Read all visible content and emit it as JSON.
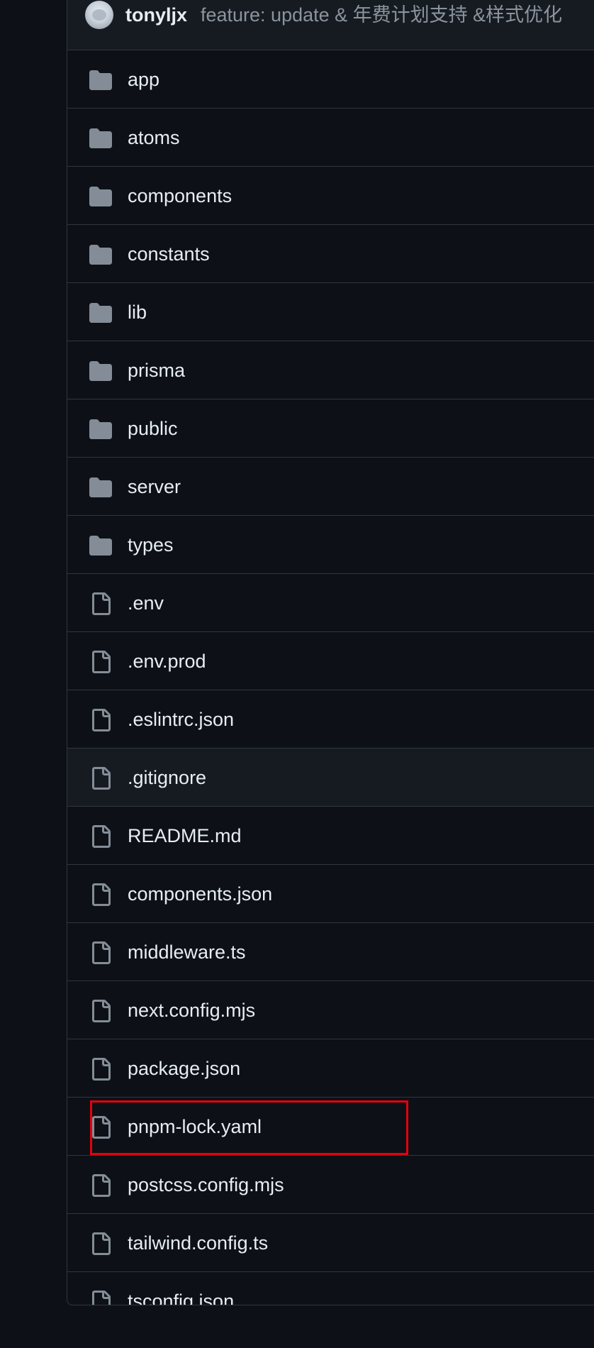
{
  "commit": {
    "author": "tonyljx",
    "message": "feature: update & 年费计划支持 &样式优化"
  },
  "files": [
    {
      "name": "app",
      "type": "folder",
      "icon": "folder-icon"
    },
    {
      "name": "atoms",
      "type": "folder",
      "icon": "folder-icon"
    },
    {
      "name": "components",
      "type": "folder",
      "icon": "folder-icon"
    },
    {
      "name": "constants",
      "type": "folder",
      "icon": "folder-icon"
    },
    {
      "name": "lib",
      "type": "folder",
      "icon": "folder-icon"
    },
    {
      "name": "prisma",
      "type": "folder",
      "icon": "folder-icon"
    },
    {
      "name": "public",
      "type": "folder",
      "icon": "folder-icon"
    },
    {
      "name": "server",
      "type": "folder",
      "icon": "folder-icon"
    },
    {
      "name": "types",
      "type": "folder",
      "icon": "folder-icon"
    },
    {
      "name": ".env",
      "type": "file",
      "icon": "file-icon"
    },
    {
      "name": ".env.prod",
      "type": "file",
      "icon": "file-icon"
    },
    {
      "name": ".eslintrc.json",
      "type": "file",
      "icon": "file-icon"
    },
    {
      "name": ".gitignore",
      "type": "file",
      "icon": "file-icon",
      "hovered": true
    },
    {
      "name": "README.md",
      "type": "file",
      "icon": "file-icon"
    },
    {
      "name": "components.json",
      "type": "file",
      "icon": "file-icon"
    },
    {
      "name": "middleware.ts",
      "type": "file",
      "icon": "file-icon"
    },
    {
      "name": "next.config.mjs",
      "type": "file",
      "icon": "file-icon"
    },
    {
      "name": "package.json",
      "type": "file",
      "icon": "file-icon"
    },
    {
      "name": "pnpm-lock.yaml",
      "type": "file",
      "icon": "file-icon",
      "highlighted": true
    },
    {
      "name": "postcss.config.mjs",
      "type": "file",
      "icon": "file-icon"
    },
    {
      "name": "tailwind.config.ts",
      "type": "file",
      "icon": "file-icon"
    },
    {
      "name": "tsconfig.json",
      "type": "file",
      "icon": "file-icon"
    }
  ],
  "colors": {
    "background": "#0d1117",
    "header_background": "#161b22",
    "border": "#30363d",
    "text": "#e6edf3",
    "muted_text": "#8b949e",
    "icon": "#848d97",
    "highlight": "#e5000a"
  }
}
